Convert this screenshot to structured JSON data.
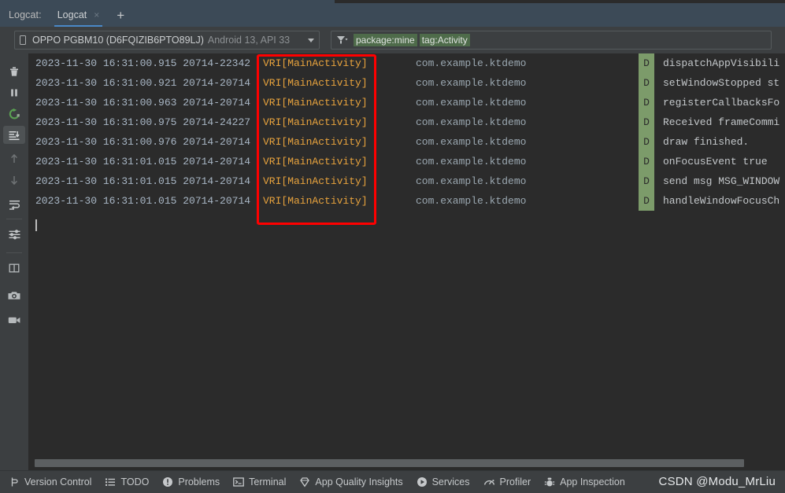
{
  "window": {
    "tool_window_label": "Logcat:",
    "tabs": [
      {
        "label": "Logcat",
        "close_icon": "×",
        "active": true
      }
    ],
    "add_tab_icon": "+"
  },
  "toolbar": {
    "device": {
      "icon": "phone-icon",
      "name": "OPPO PGBM10 (D6FQIZIB6PTO89LJ)",
      "meta": "Android 13, API 33",
      "dropdown_icon": "chevron-down-icon"
    },
    "filter": {
      "icon": "funnel-icon",
      "chips": [
        "package:mine",
        "tag:Activity"
      ],
      "chip_color": "#4e6b4a"
    }
  },
  "rail": {
    "items": [
      {
        "name": "clear-logcat-button",
        "icon": "trash-icon",
        "selected": false
      },
      {
        "name": "pause-button",
        "icon": "pause-icon",
        "selected": false
      },
      {
        "name": "restart-button",
        "icon": "restart-icon",
        "selected": false,
        "color": "#5aa052"
      },
      {
        "name": "scroll-to-end-button",
        "icon": "scroll-to-end-icon",
        "selected": true
      },
      {
        "name": "previous-occurrence-button",
        "icon": "arrow-up-icon",
        "selected": false
      },
      {
        "name": "next-occurrence-button",
        "icon": "arrow-down-icon",
        "selected": false
      },
      {
        "name": "soft-wrap-button",
        "icon": "soft-wrap-icon",
        "selected": false
      },
      {
        "name": "configure-button",
        "icon": "sliders-icon",
        "selected": false
      },
      {
        "name": "split-panel-button",
        "icon": "split-panel-icon",
        "selected": false
      },
      {
        "name": "screenshot-button",
        "icon": "camera-icon",
        "selected": false
      },
      {
        "name": "screen-record-button",
        "icon": "video-camera-icon",
        "selected": false
      }
    ]
  },
  "log": {
    "columns": [
      "timestamp",
      "pid",
      "tag",
      "package",
      "level",
      "message"
    ],
    "rows": [
      {
        "timestamp": "2023-11-30 16:31:00.915",
        "pid": "20714-22342",
        "tag": "VRI[MainActivity]",
        "package": "com.example.ktdemo",
        "level": "D",
        "message": "dispatchAppVisibili"
      },
      {
        "timestamp": "2023-11-30 16:31:00.921",
        "pid": "20714-20714",
        "tag": "VRI[MainActivity]",
        "package": "com.example.ktdemo",
        "level": "D",
        "message": "setWindowStopped st"
      },
      {
        "timestamp": "2023-11-30 16:31:00.963",
        "pid": "20714-20714",
        "tag": "VRI[MainActivity]",
        "package": "com.example.ktdemo",
        "level": "D",
        "message": "registerCallbacksFo"
      },
      {
        "timestamp": "2023-11-30 16:31:00.975",
        "pid": "20714-24227",
        "tag": "VRI[MainActivity]",
        "package": "com.example.ktdemo",
        "level": "D",
        "message": "Received frameCommi"
      },
      {
        "timestamp": "2023-11-30 16:31:00.976",
        "pid": "20714-20714",
        "tag": "VRI[MainActivity]",
        "package": "com.example.ktdemo",
        "level": "D",
        "message": "draw finished."
      },
      {
        "timestamp": "2023-11-30 16:31:01.015",
        "pid": "20714-20714",
        "tag": "VRI[MainActivity]",
        "package": "com.example.ktdemo",
        "level": "D",
        "message": "onFocusEvent true"
      },
      {
        "timestamp": "2023-11-30 16:31:01.015",
        "pid": "20714-20714",
        "tag": "VRI[MainActivity]",
        "package": "com.example.ktdemo",
        "level": "D",
        "message": "send msg MSG_WINDOW"
      },
      {
        "timestamp": "2023-11-30 16:31:01.015",
        "pid": "20714-20714",
        "tag": "VRI[MainActivity]",
        "package": "com.example.ktdemo",
        "level": "D",
        "message": "handleWindowFocusCh"
      }
    ],
    "tag_color": "#e8a33d",
    "level_badge_color": "#7c9b6a"
  },
  "annotation": {
    "highlight_color": "#ff0000",
    "target": "tag-column"
  },
  "statusbar": {
    "items": [
      {
        "icon": "branch-icon",
        "label": "Version Control"
      },
      {
        "icon": "list-icon",
        "label": "TODO"
      },
      {
        "icon": "exclamation-circle-icon",
        "label": "Problems"
      },
      {
        "icon": "terminal-icon",
        "label": "Terminal"
      },
      {
        "icon": "diamond-icon",
        "label": "App Quality Insights"
      },
      {
        "icon": "play-circle-icon",
        "label": "Services"
      },
      {
        "icon": "gauge-icon",
        "label": "Profiler"
      },
      {
        "icon": "bug-icon",
        "label": "App Inspection"
      }
    ],
    "watermark": "CSDN @Modu_MrLiu"
  }
}
